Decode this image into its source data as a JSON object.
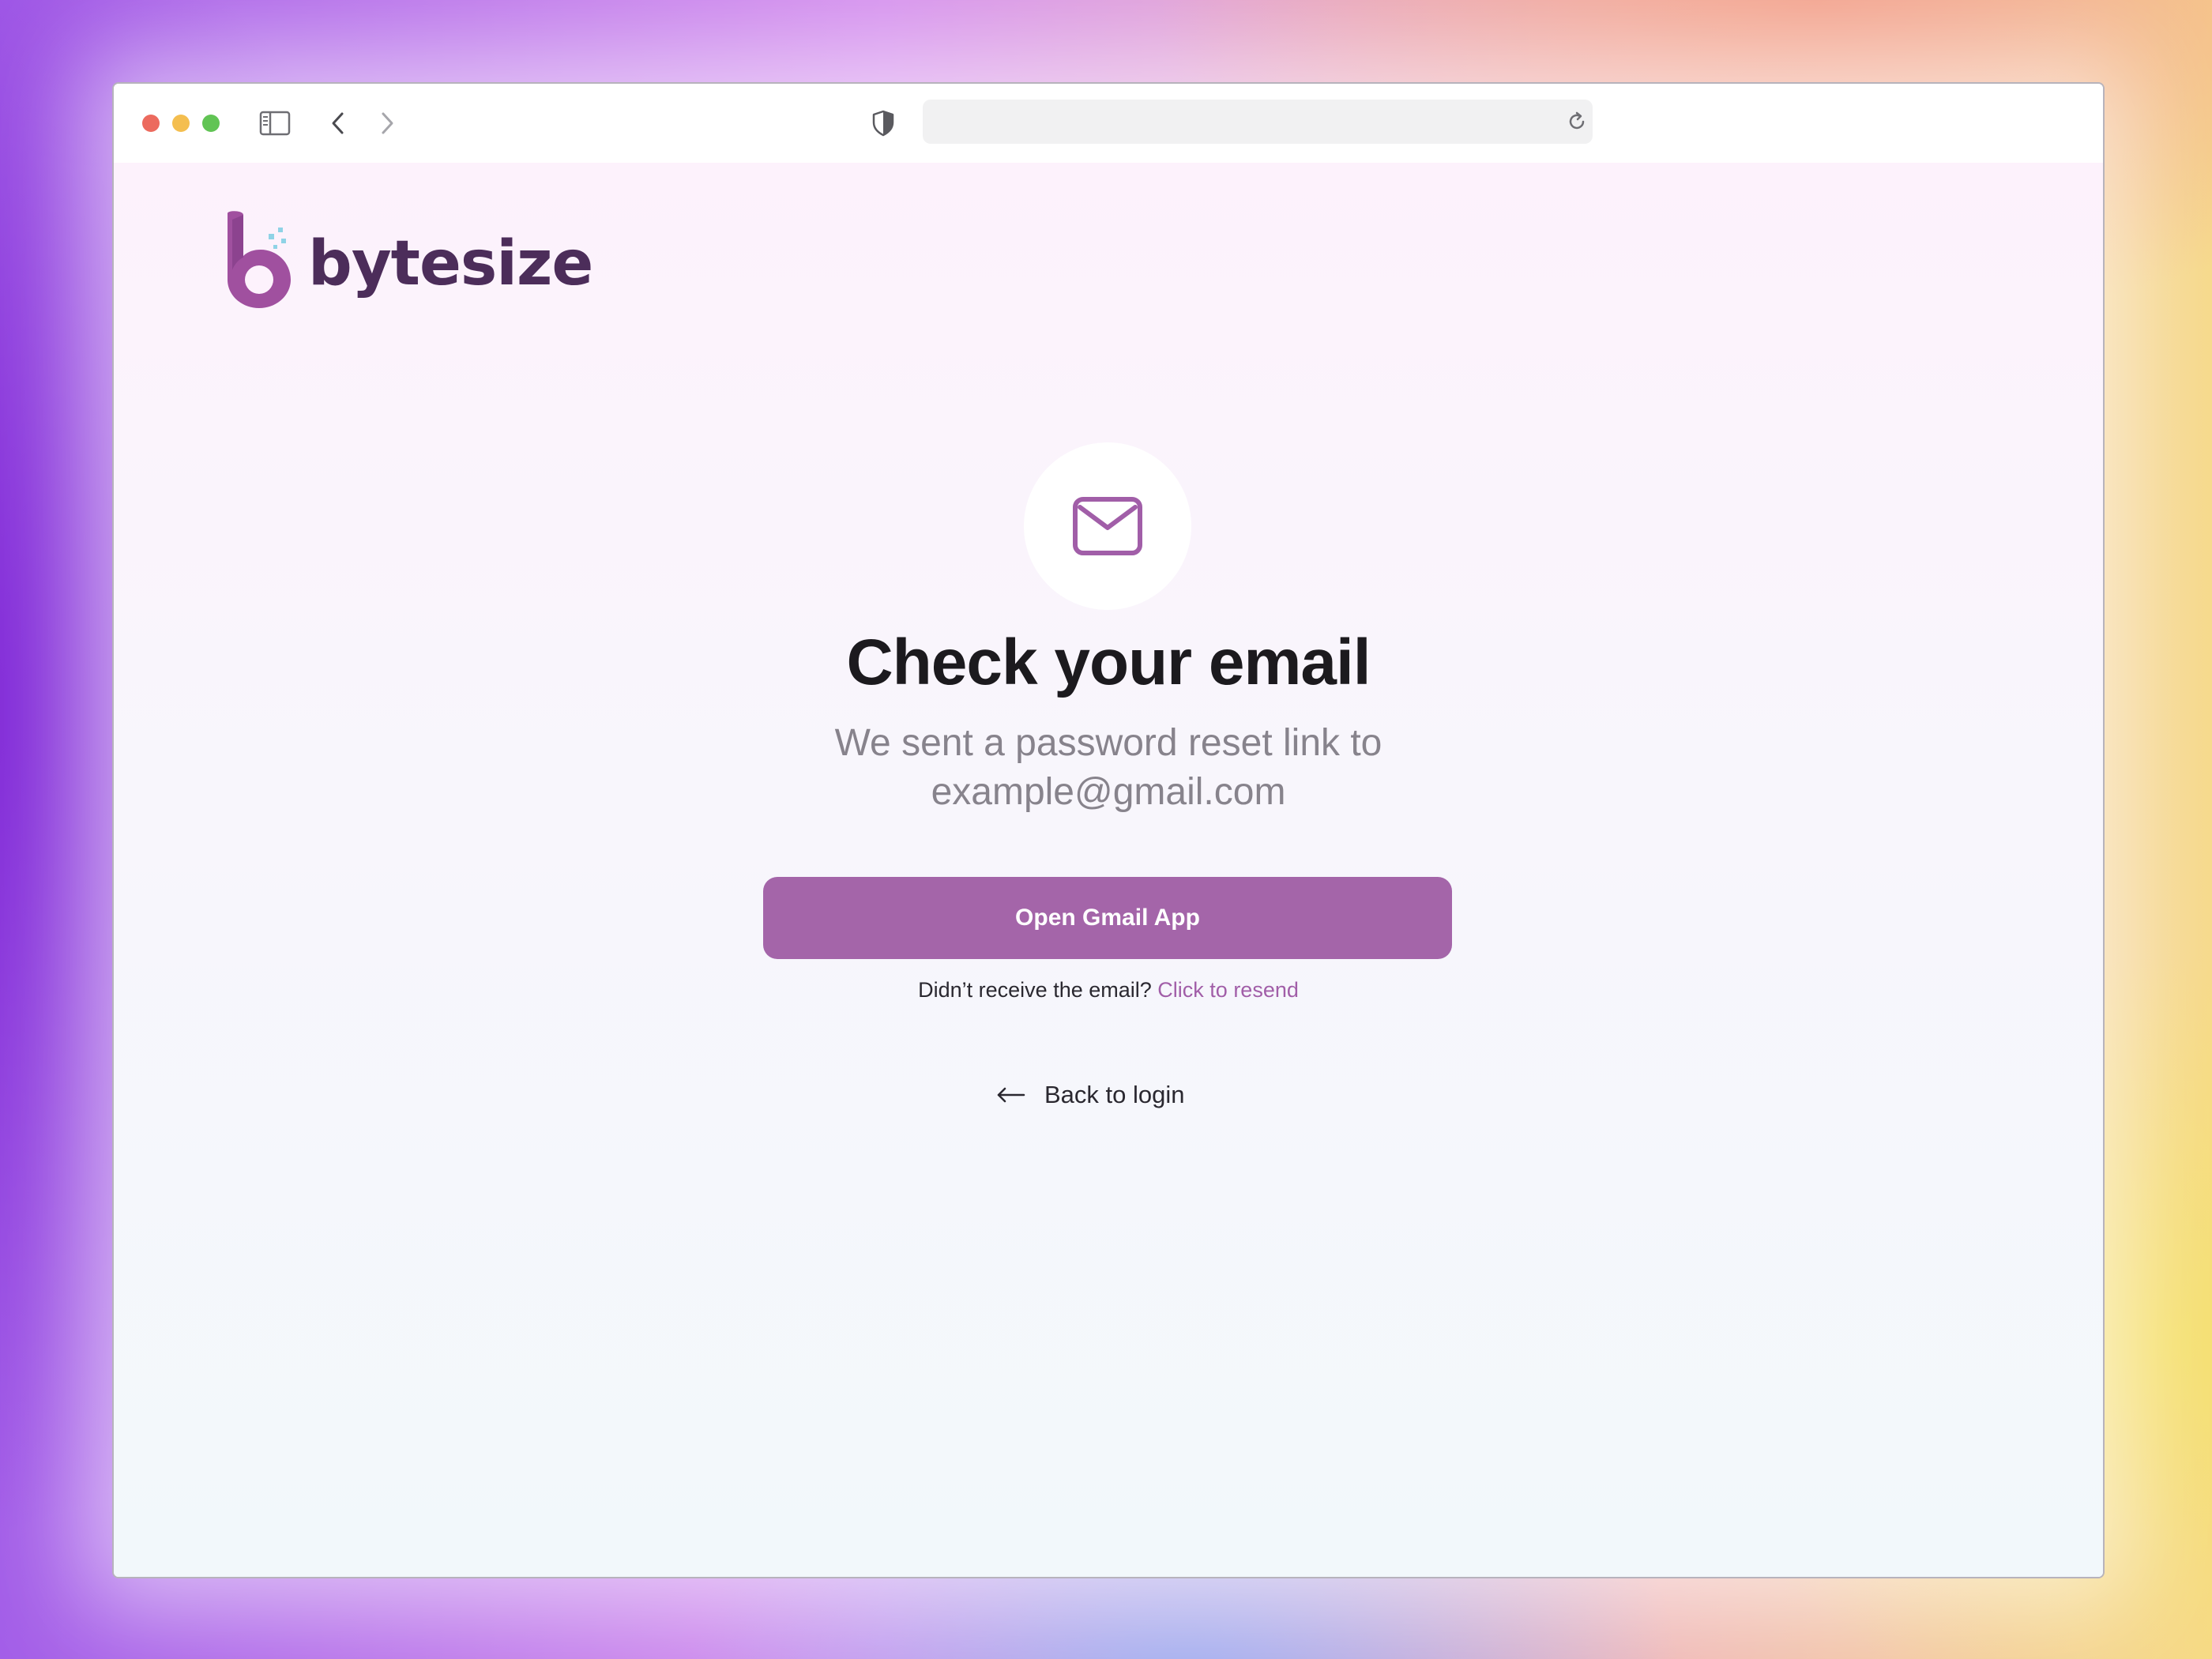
{
  "brand": {
    "name": "bytesize",
    "text_color": "#4c2d5a",
    "accent": "#a465a9"
  },
  "browser": {
    "address_value": "",
    "icons": [
      "sidebar-icon",
      "back-arrow-icon",
      "forward-arrow-icon",
      "shield-icon",
      "reload-icon"
    ]
  },
  "main": {
    "icon": "mail-icon",
    "title": "Check your email",
    "subtitle_line1": "We sent a password reset link to",
    "subtitle_email": "example@gmail.com",
    "primary_button": "Open Gmail App",
    "resend_prompt": "Didn’t receive the email?",
    "resend_link": "Click to resend",
    "back_link": "Back to login"
  }
}
